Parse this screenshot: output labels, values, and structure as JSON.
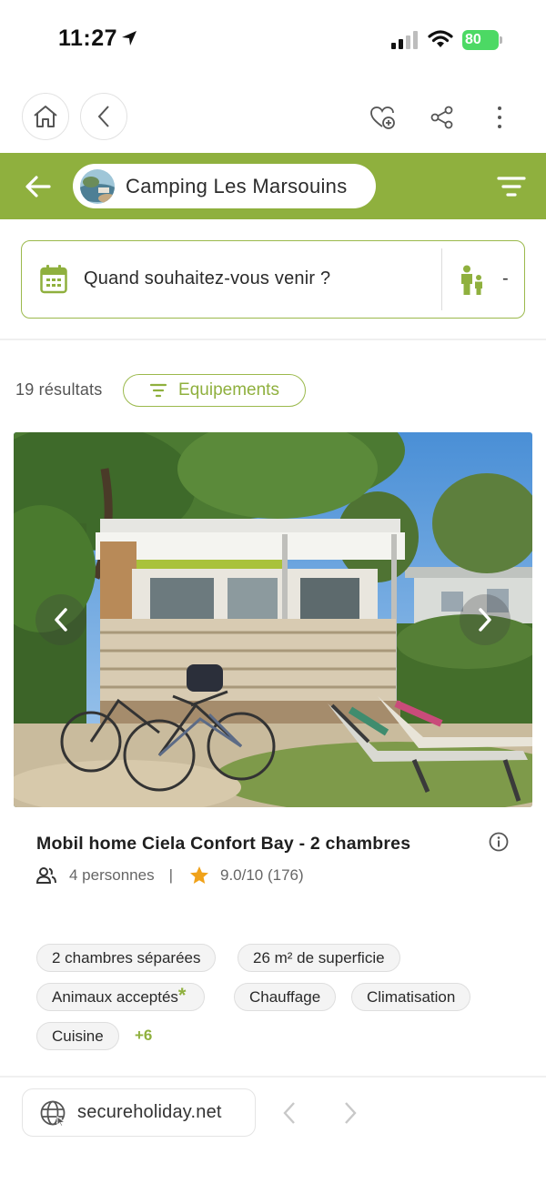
{
  "status_bar": {
    "time": "11:27",
    "battery": "80"
  },
  "toolbar": {
    "home_icon": "home-icon",
    "back_icon": "chevron-left-icon",
    "favorite_icon": "heart-plus-icon",
    "share_icon": "share-icon",
    "more_icon": "more-vertical-icon"
  },
  "header": {
    "camp_name": "Camping Les Marsouins",
    "accent_color": "#8fb03e"
  },
  "search": {
    "date_prompt": "Quand souhaitez-vous venir ?",
    "guests_value": "-"
  },
  "results": {
    "count_label": "19 résultats",
    "filter_label": "Equipements"
  },
  "listing": {
    "title": "Mobil home Ciela Confort Bay - 2 chambres",
    "persons": "4 personnes",
    "separator": "|",
    "rating": "9.0/10 (176)",
    "tags": [
      "2 chambres séparées",
      "26 m² de superficie",
      "Animaux acceptés",
      "Chauffage",
      "Climatisation",
      "Cuisine"
    ],
    "tag_asterisk": "*",
    "more_tags": "+6"
  },
  "bottom_bar": {
    "url": "secureholiday.net"
  }
}
